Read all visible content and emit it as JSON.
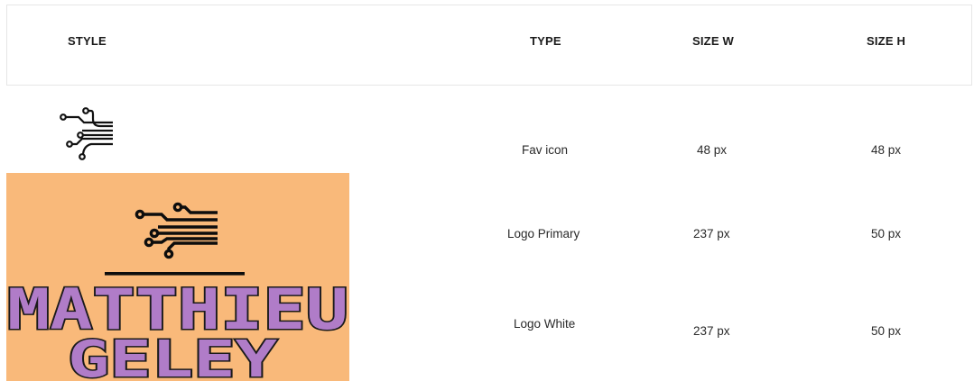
{
  "table": {
    "headers": {
      "style": "STYLE",
      "type": "TYPE",
      "size_w": "SIZE W",
      "size_h": "SIZE H"
    },
    "rows": [
      {
        "type": "Fav icon",
        "size_w": "48 px",
        "size_h": "48 px"
      },
      {
        "type": "Logo Primary",
        "size_w": "237 px",
        "size_h": "50 px"
      },
      {
        "type": "Logo White",
        "size_w": "237 px",
        "size_h": "50 px"
      }
    ]
  },
  "logo": {
    "line1": "MATTHIEU",
    "line2": "GELEY",
    "background_color": "#f9b97a",
    "text_fill_color": "#b07cc8",
    "text_stroke_color": "#1a1a1a",
    "icon": "circuit-lines-icon"
  }
}
